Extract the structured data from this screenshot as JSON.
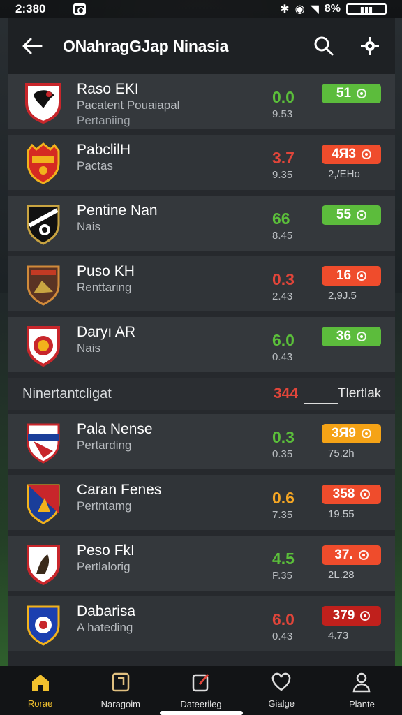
{
  "status_bar": {
    "time": "2:380",
    "battery": "8%"
  },
  "header": {
    "title": "ONahragGJap Ninasia"
  },
  "colors": {
    "green": "#5bbf3a",
    "red": "#e0453a",
    "orange": "#f5a623",
    "pill_green": "#5cbc3c",
    "pill_red": "#ef4c2c",
    "pill_orange": "#f5a316",
    "pill_darkred": "#c0201c"
  },
  "rows": [
    {
      "name": "Raso EKI",
      "sub": "Pacatent Pouaiapal",
      "sub2": "Pertaniing",
      "odds": "0.0",
      "odds_sub": "9.53",
      "odds_color": "green",
      "pill": "51",
      "pill_color": "green",
      "pill_sub": "",
      "logo": "team-logo-1"
    },
    {
      "name": "PabclilH",
      "sub": "Pactas",
      "sub2": "",
      "odds": "3.7",
      "odds_sub": "9.35",
      "odds_color": "red",
      "pill": "4Я3",
      "pill_color": "red",
      "pill_sub": "2,/EHo",
      "logo": "team-logo-2"
    },
    {
      "name": "Pentine Nan",
      "sub": "Nais",
      "sub2": "",
      "odds": "66",
      "odds_sub": "8.45",
      "odds_color": "green",
      "pill": "55",
      "pill_color": "green",
      "pill_sub": "",
      "logo": "team-logo-3"
    },
    {
      "name": "Puso KH",
      "sub": "Renttaring",
      "sub2": "",
      "odds": "0.3",
      "odds_sub": "2.43",
      "odds_color": "red",
      "pill": "16",
      "pill_color": "red",
      "pill_sub": "2,9J.5",
      "logo": "team-logo-4"
    },
    {
      "name": "Daryı AR",
      "sub": "Nais",
      "sub2": "",
      "odds": "6.0",
      "odds_sub": "0.43",
      "odds_color": "green",
      "pill": "36",
      "pill_color": "green",
      "pill_sub": "",
      "logo": "team-logo-5"
    }
  ],
  "section": {
    "title": "Ninertantcligat",
    "count": "344",
    "link": "Tlertlak"
  },
  "rows2": [
    {
      "name": "Pala Nense",
      "sub": "Pertarding",
      "odds": "0.3",
      "odds_sub": "0.35",
      "odds_color": "green",
      "pill": "3Я9",
      "pill_color": "orange",
      "pill_sub": "75.2h",
      "logo": "team-logo-6"
    },
    {
      "name": "Caran Fenes",
      "sub": "Pertntamg",
      "odds": "0.6",
      "odds_sub": "7.35",
      "odds_color": "orange",
      "pill": "358",
      "pill_color": "red",
      "pill_sub": "19.55",
      "logo": "team-logo-7"
    },
    {
      "name": "Peso FkI",
      "sub": "Pertlalorig",
      "odds": "4.5",
      "odds_sub": "P.35",
      "odds_color": "green",
      "pill": "37.",
      "pill_color": "red",
      "pill_sub": "2L.28",
      "logo": "team-logo-8"
    },
    {
      "name": "Dabarisa",
      "sub": "A hateding",
      "odds": "6.0",
      "odds_sub": "0.43",
      "odds_color": "red",
      "pill": "379",
      "pill_color": "darkred",
      "pill_sub": "4.73",
      "logo": "team-logo-9"
    }
  ],
  "nav": [
    {
      "label": "Rorae",
      "icon": "home-icon"
    },
    {
      "label": "Naragoim",
      "icon": "matches-icon"
    },
    {
      "label": "Dateerileg",
      "icon": "betslip-icon"
    },
    {
      "label": "Gialge",
      "icon": "favorites-icon"
    },
    {
      "label": "Plante",
      "icon": "profile-icon"
    }
  ]
}
